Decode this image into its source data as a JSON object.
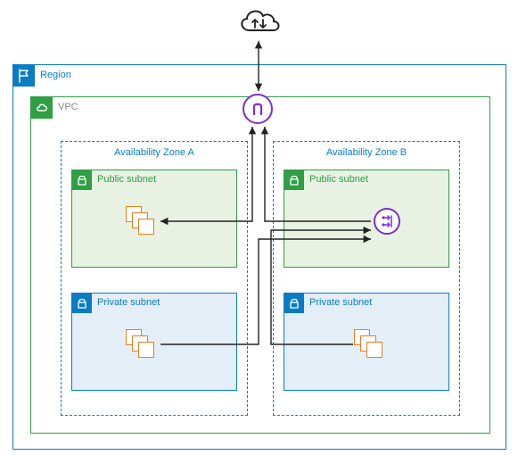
{
  "region": {
    "label": "Region"
  },
  "vpc": {
    "label": "VPC"
  },
  "availability_zones": [
    {
      "label": "Availability Zone A"
    },
    {
      "label": "Availability Zone B"
    }
  ],
  "subnets": {
    "public_label": "Public subnet",
    "private_label": "Private subnet"
  },
  "icons": {
    "cloud": "cloud-internet-icon",
    "region_flag": "region-flag-icon",
    "vpc_cloud": "vpc-cloud-icon",
    "lock": "lock-icon",
    "instances": "instances-stack-icon",
    "internet_gateway": "internet-gateway-icon",
    "nat_gateway": "nat-gateway-icon"
  },
  "colors": {
    "region_blue": "#0a7cc4",
    "vpc_green": "#2f9e44",
    "subnet_public_bg": "#e8f2e2",
    "subnet_private_bg": "#e4eef6",
    "instance_orange": "#e67e22",
    "gateway_purple": "#7b2fd6",
    "arrow": "#222222"
  },
  "connections": [
    {
      "from": "internet-cloud",
      "to": "internet-gateway",
      "bidirectional": true
    },
    {
      "from": "az-a-public-instances",
      "to": "internet-gateway",
      "bidirectional": true
    },
    {
      "from": "nat-gateway",
      "to": "internet-gateway",
      "bidirectional": false
    },
    {
      "from": "az-a-private-instances",
      "to": "nat-gateway",
      "bidirectional": false
    },
    {
      "from": "az-b-private-instances",
      "to": "nat-gateway",
      "bidirectional": false
    }
  ]
}
